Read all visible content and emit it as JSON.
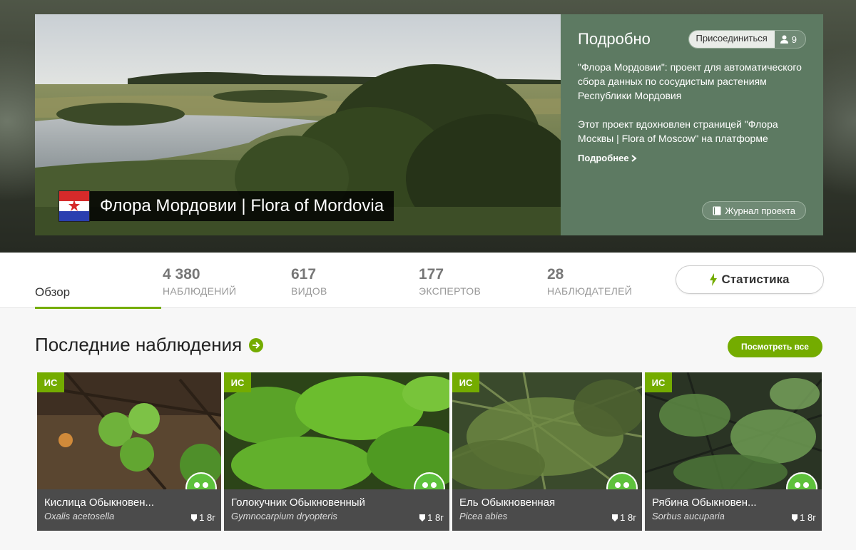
{
  "hero": {
    "project_title": "Флора Мордовии | Flora of Mordovia",
    "info": {
      "title": "Подробно",
      "join_label": "Присоединиться",
      "members_count": "9",
      "description_1": "\"Флора Мордовии\": проект для автоматического сбора данных по сосудистым растениям Республики Мордовия",
      "description_2": "Этот проект вдохновлен страницей \"Флора Москвы | Flora of Moscow\" на платформе",
      "more_label": "Подробнее",
      "journal_label": "Журнал проекта"
    },
    "colors": {
      "panel": "#5d7a62",
      "flag_red": "#d62a2a",
      "flag_blue": "#2a3fb0"
    }
  },
  "stats": {
    "overview_label": "Обзор",
    "items": [
      {
        "value": "4 380",
        "label": "НАБЛЮДЕНИЙ"
      },
      {
        "value": "617",
        "label": "ВИДОВ"
      },
      {
        "value": "177",
        "label": "ЭКСПЕРТОВ"
      },
      {
        "value": "28",
        "label": "НАБЛЮДАТЕЛЕЙ"
      }
    ],
    "statistics_button": "Статистика"
  },
  "recent": {
    "title": "Последние наблюдения",
    "view_all_label": "Посмотреть все",
    "accent_color": "#74ac00",
    "cards": [
      {
        "grade": "ИС",
        "common_name": "Кислица Обыкновен...",
        "scientific_name": "Oxalis acetosella",
        "age": "1 8г"
      },
      {
        "grade": "ИС",
        "common_name": "Голокучник Обыкновенный",
        "scientific_name": "Gymnocarpium dryopteris",
        "age": "1 8г"
      },
      {
        "grade": "ИС",
        "common_name": "Ель Обыкновенная",
        "scientific_name": "Picea abies",
        "age": "1 8г"
      },
      {
        "grade": "ИС",
        "common_name": "Рябина Обыкновен...",
        "scientific_name": "Sorbus aucuparia",
        "age": "1 8г"
      }
    ]
  }
}
